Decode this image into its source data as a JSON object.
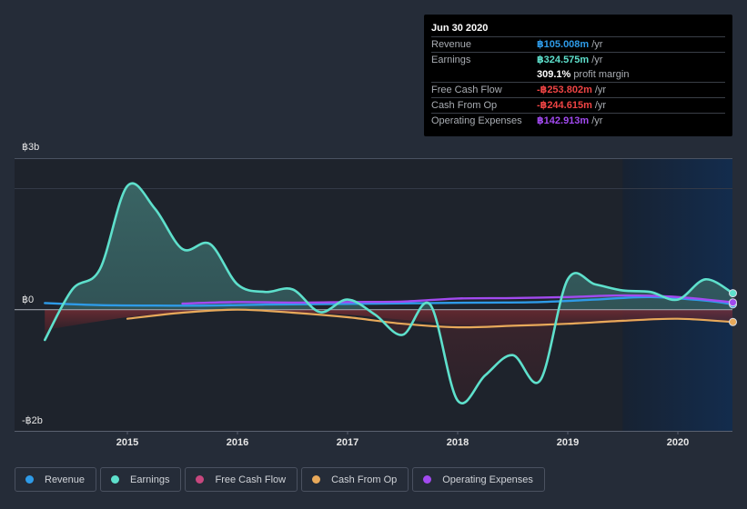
{
  "tooltip": {
    "date": "Jun 30 2020",
    "rows": [
      {
        "label": "Revenue",
        "value": "฿105.008m",
        "unit": "/yr",
        "color": "#2e9be8"
      },
      {
        "label": "Earnings",
        "value": "฿324.575m",
        "unit": "/yr",
        "color": "#5ee0cc"
      },
      {
        "label": "Free Cash Flow",
        "value": "-฿253.802m",
        "unit": "/yr",
        "color": "#ef4444"
      },
      {
        "label": "Cash From Op",
        "value": "-฿244.615m",
        "unit": "/yr",
        "color": "#ef4444"
      },
      {
        "label": "Operating Expenses",
        "value": "฿142.913m",
        "unit": "/yr",
        "color": "#a24af0"
      }
    ],
    "profit_margin": {
      "value": "309.1%",
      "text": "profit margin"
    }
  },
  "legend": [
    {
      "label": "Revenue",
      "color": "#2e9be8"
    },
    {
      "label": "Earnings",
      "color": "#5ee0cc"
    },
    {
      "label": "Free Cash Flow",
      "color": "#c7477e"
    },
    {
      "label": "Cash From Op",
      "color": "#e8a95a"
    },
    {
      "label": "Operating Expenses",
      "color": "#a24af0"
    }
  ],
  "chart_data": {
    "type": "line",
    "title": "",
    "xlabel": "",
    "ylabel": "",
    "currency_symbol": "฿",
    "ylim": [
      -2.4,
      3.0
    ],
    "xlim": [
      2014.0,
      2020.5
    ],
    "y_tick_labels": [
      {
        "value": 3,
        "label": "฿3b"
      },
      {
        "value": 0,
        "label": "฿0"
      },
      {
        "value": -2,
        "label": "-฿2b"
      }
    ],
    "x_tick_labels": [
      {
        "value": 2015,
        "label": "2015"
      },
      {
        "value": 2016,
        "label": "2016"
      },
      {
        "value": 2017,
        "label": "2017"
      },
      {
        "value": 2018,
        "label": "2018"
      },
      {
        "value": 2019,
        "label": "2019"
      },
      {
        "value": 2020,
        "label": "2020"
      }
    ],
    "highlight_region": {
      "from": 2019.5,
      "to": 2020.5
    },
    "units": "billions",
    "series": [
      {
        "name": "Revenue",
        "color": "#2e9be8",
        "x": [
          2014.25,
          2014.75,
          2015.25,
          2015.75,
          2016.25,
          2016.75,
          2017.25,
          2017.75,
          2018.25,
          2018.75,
          2019.25,
          2019.75,
          2020.25,
          2020.5
        ],
        "y": [
          0.13,
          0.09,
          0.08,
          0.08,
          0.1,
          0.11,
          0.12,
          0.13,
          0.14,
          0.15,
          0.2,
          0.25,
          0.18,
          0.105
        ]
      },
      {
        "name": "Earnings",
        "color": "#5ee0cc",
        "x": [
          2014.25,
          2014.5,
          2014.75,
          2015.0,
          2015.25,
          2015.5,
          2015.75,
          2016.0,
          2016.25,
          2016.5,
          2016.75,
          2017.0,
          2017.25,
          2017.5,
          2017.75,
          2018.0,
          2018.25,
          2018.5,
          2018.75,
          2019.0,
          2019.25,
          2019.5,
          2019.75,
          2020.0,
          2020.25,
          2020.5
        ],
        "y": [
          -0.6,
          0.4,
          0.8,
          2.45,
          2.0,
          1.2,
          1.3,
          0.5,
          0.35,
          0.4,
          -0.05,
          0.2,
          -0.1,
          -0.5,
          0.1,
          -1.8,
          -1.3,
          -0.9,
          -1.4,
          0.6,
          0.5,
          0.38,
          0.35,
          0.2,
          0.6,
          0.325
        ]
      },
      {
        "name": "Free Cash Flow",
        "color": "#c7477e",
        "x": [
          2014.25,
          2015.0,
          2015.5,
          2016.0,
          2016.5,
          2017.0,
          2017.5,
          2018.0,
          2018.5,
          2019.0,
          2019.5,
          2020.0,
          2020.5
        ],
        "y": [
          -0.4,
          -0.15,
          -0.06,
          0.0,
          -0.05,
          -0.1,
          -0.2,
          -0.3,
          -0.32,
          -0.3,
          -0.25,
          -0.2,
          -0.254
        ]
      },
      {
        "name": "Cash From Op",
        "color": "#e8a95a",
        "x": [
          2015.0,
          2015.5,
          2016.0,
          2016.5,
          2017.0,
          2017.5,
          2018.0,
          2018.5,
          2019.0,
          2019.5,
          2020.0,
          2020.5
        ],
        "y": [
          -0.18,
          -0.06,
          0.0,
          -0.06,
          -0.15,
          -0.28,
          -0.35,
          -0.32,
          -0.28,
          -0.22,
          -0.18,
          -0.245
        ]
      },
      {
        "name": "Operating Expenses",
        "color": "#a24af0",
        "x": [
          2015.5,
          2016.0,
          2016.5,
          2017.0,
          2017.5,
          2018.0,
          2018.5,
          2019.0,
          2019.5,
          2020.0,
          2020.5
        ],
        "y": [
          0.12,
          0.15,
          0.14,
          0.15,
          0.16,
          0.22,
          0.23,
          0.25,
          0.28,
          0.25,
          0.143
        ]
      }
    ]
  }
}
